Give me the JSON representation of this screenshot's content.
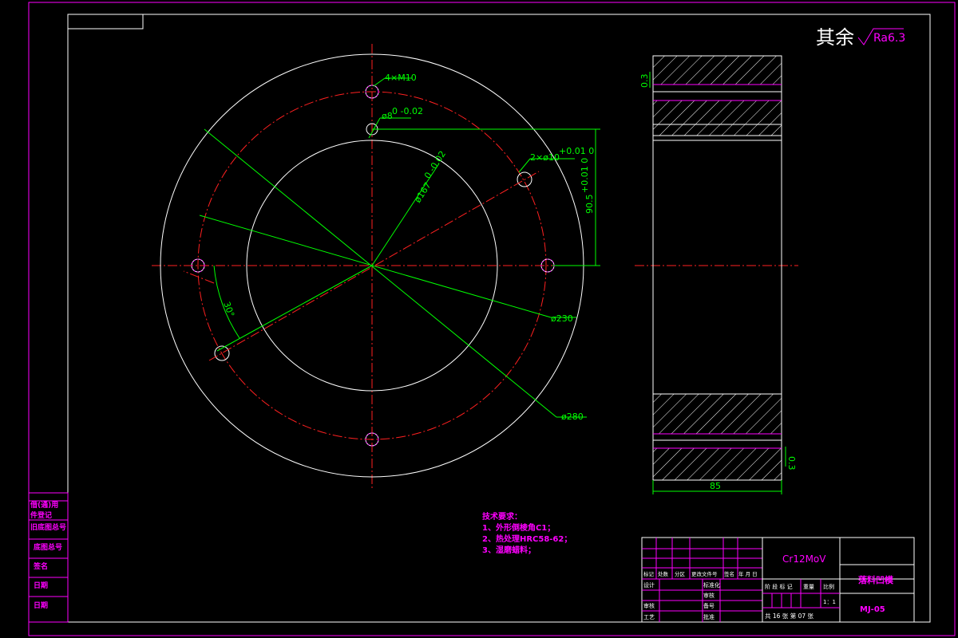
{
  "roughness": {
    "prefix": "其余",
    "value": "Ra6.3"
  },
  "dims": {
    "thread": "4×M10",
    "pin_hole": "ø8",
    "pin_hole_tol": "0 -0.02",
    "bore": "ø167",
    "bore_tol": "0 -0.02",
    "pin_hole2": "2×ø10",
    "pin_hole2_tol": "+0.01 0",
    "offset": "90.5",
    "offset_tol": "+0.01 0",
    "angle": "30°",
    "pcd": "ø230",
    "outer": "ø280",
    "width": "85",
    "side_left": "0.3",
    "side_right": "0.3"
  },
  "tech": {
    "title": "技术要求：",
    "items": [
      "1、外形倒棱角C1；",
      "2、热处理HRC58-62；",
      "3、湿磨蜡料；"
    ]
  },
  "title_block": {
    "material": "Cr12MoV",
    "part_name": "落料凹模",
    "drawing_no": "MJ-05",
    "scale": "1：1",
    "sheet": "共 16 张    第 07 张",
    "hdr": [
      "标记",
      "处数",
      "分区",
      "更改文件号",
      "签名",
      "年 月 日"
    ],
    "rows": [
      [
        "设计",
        "",
        "标准化"
      ],
      [
        "",
        "",
        "审核"
      ],
      [
        "审核",
        "",
        "备号"
      ],
      [
        "工艺",
        "",
        "批准"
      ]
    ],
    "stage": [
      "阶 段 标 记",
      "重量",
      "比例"
    ]
  },
  "left_strip": [
    "借(通)用",
    "件登记",
    "旧底图总号",
    "底图总号",
    "签名",
    "日期",
    "日期"
  ]
}
